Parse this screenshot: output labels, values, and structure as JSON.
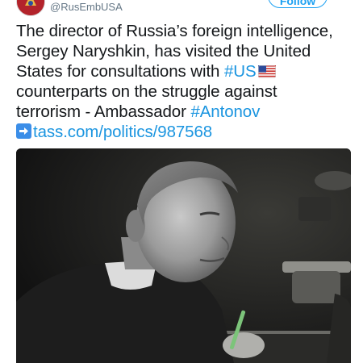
{
  "account": {
    "handle": "@RusEmbUSA",
    "follow_label": "Follow"
  },
  "tweet": {
    "line1": "The director of Russia’s foreign intelligence,",
    "line2": "Sergey Naryshkin, has visited the United",
    "line3_prefix": "States for consultations with ",
    "hashtag_us": "#US",
    "line4_prefix": "counterparts on the struggle against",
    "line5_prefix": "terrorism - Ambassador ",
    "hashtag_antonov": "#Antonov",
    "link_text": "tass.com/politics/987568"
  },
  "icons": {
    "flag": "us-flag-emoji",
    "arrow": "right-arrow-emoji"
  },
  "colors": {
    "link": "#1b95e0",
    "text": "#14171a",
    "handle": "#657786",
    "follow": "#1da1f2"
  }
}
